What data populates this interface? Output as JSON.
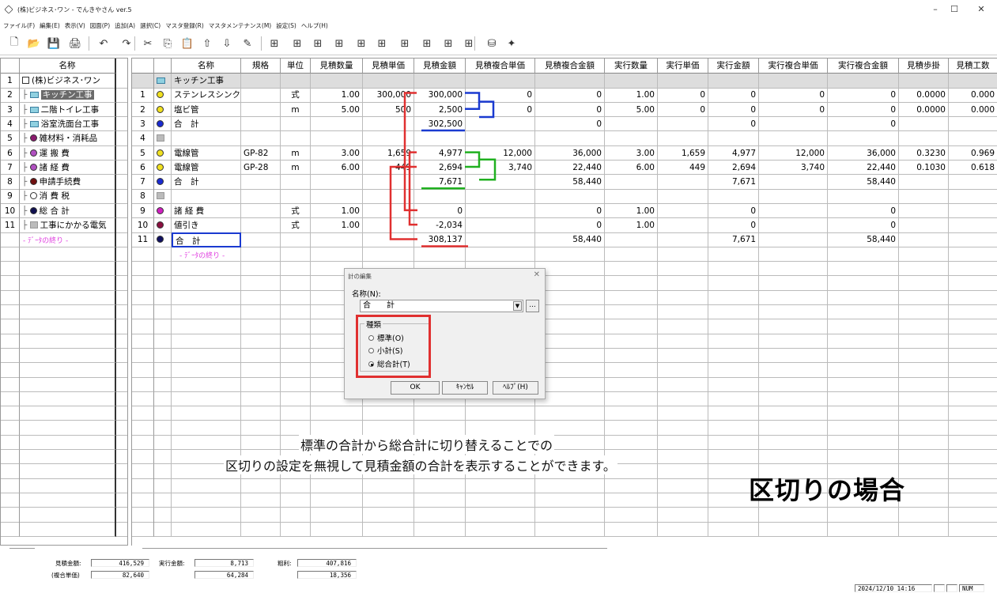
{
  "window": {
    "title": "(株)ビジネス･ワン - でんきやさん ver.5",
    "minimize": "–",
    "maximize": "☐",
    "close": "✕"
  },
  "menu": [
    "ファイル(F)",
    "編集(E)",
    "表示(V)",
    "図面(P)",
    "追加(A)",
    "選択(C)",
    "マスタ登録(R)",
    "マスタメンテナンス(M)",
    "設定(S)",
    "ヘルプ(H)"
  ],
  "toolbar_icons": [
    "new-file-icon",
    "open-folder-icon",
    "save-icon",
    "print-icon",
    "undo-icon",
    "redo-icon",
    "cut-icon",
    "copy-icon",
    "paste-icon",
    "move-up-icon",
    "move-down-icon",
    "edit-icon",
    "tool-1-icon",
    "tool-2-icon",
    "tool-3-icon",
    "tool-4-icon",
    "tool-5-icon",
    "tool-6-icon",
    "tool-7-icon",
    "tool-8-icon",
    "tool-9-icon",
    "tool-10-icon",
    "database-icon",
    "pin-icon"
  ],
  "tree": {
    "header": "名称",
    "rows": [
      {
        "n": "1",
        "label": "(株)ビジネス･ワン",
        "icon": "folder-icon"
      },
      {
        "n": "2",
        "label": "キッチン工事",
        "icon": "item-icon",
        "selected": true
      },
      {
        "n": "3",
        "label": "二階トイレ工事",
        "icon": "item-icon"
      },
      {
        "n": "4",
        "label": "浴室洗面台工事",
        "icon": "item-icon"
      },
      {
        "n": "5",
        "label": "雑材料・消耗品",
        "icon": "dot-icon",
        "color": "#8a1a6e"
      },
      {
        "n": "6",
        "label": "運 搬 費",
        "icon": "dot-icon",
        "color": "#b050c0"
      },
      {
        "n": "7",
        "label": "諸 経 費",
        "icon": "dot-icon",
        "color": "#b050c0"
      },
      {
        "n": "8",
        "label": "申請手続費",
        "icon": "dot-icon",
        "color": "#701010"
      },
      {
        "n": "9",
        "label": "消 費 税",
        "icon": "dot-icon",
        "color": "#ffffff"
      },
      {
        "n": "10",
        "label": "総 合 計",
        "icon": "dot-icon",
        "color": "#101050"
      },
      {
        "n": "11",
        "label": "工事にかかる電気",
        "icon": "gray-icon"
      }
    ],
    "end_label": "- ﾃﾞｰﾀの終り -"
  },
  "grid": {
    "columns": [
      "名称",
      "規格",
      "単位",
      "見積数量",
      "見積単価",
      "見積金額",
      "見積複合単価",
      "見積複合金額",
      "実行数量",
      "実行単価",
      "実行金額",
      "実行複合単価",
      "実行複合金額",
      "見積歩掛",
      "見積工数"
    ],
    "rows": [
      {
        "n": "",
        "icon": "rect",
        "color": "",
        "name": "キッチン工事",
        "spec": "",
        "unit": "",
        "eqty": "",
        "eprice": "",
        "eamt": "",
        "ecp": "",
        "eca": "",
        "aqty": "",
        "aprice": "",
        "aamt": "",
        "acp": "",
        "aca": "",
        "bk": "",
        "work": "",
        "header": true
      },
      {
        "n": "1",
        "icon": "dot",
        "color": "#f0e020",
        "name": "ステンレスシンク",
        "spec": "",
        "unit": "式",
        "eqty": "1.00",
        "eprice": "300,000",
        "eamt": "300,000",
        "ecp": "0",
        "eca": "0",
        "aqty": "1.00",
        "aprice": "0",
        "aamt": "0",
        "acp": "0",
        "aca": "0",
        "bk": "0.0000",
        "work": "0.000"
      },
      {
        "n": "2",
        "icon": "dot",
        "color": "#f0e020",
        "name": "塩ビ管",
        "spec": "",
        "unit": "m",
        "eqty": "5.00",
        "eprice": "500",
        "eamt": "2,500",
        "ecp": "0",
        "eca": "0",
        "aqty": "5.00",
        "aprice": "0",
        "aamt": "0",
        "acp": "0",
        "aca": "0",
        "bk": "0.0000",
        "work": "0.000"
      },
      {
        "n": "3",
        "icon": "dot",
        "color": "#1a2ad0",
        "name": "合　計",
        "spec": "",
        "unit": "",
        "eqty": "",
        "eprice": "",
        "eamt": "302,500",
        "ecp": "",
        "eca": "0",
        "aqty": "",
        "aprice": "",
        "aamt": "0",
        "acp": "",
        "aca": "0",
        "bk": "",
        "work": ""
      },
      {
        "n": "4",
        "icon": "gray",
        "color": "",
        "name": "",
        "spec": "",
        "unit": "",
        "eqty": "",
        "eprice": "",
        "eamt": "",
        "ecp": "",
        "eca": "",
        "aqty": "",
        "aprice": "",
        "aamt": "",
        "acp": "",
        "aca": "",
        "bk": "",
        "work": ""
      },
      {
        "n": "5",
        "icon": "dot",
        "color": "#f0e020",
        "name": "電線管",
        "spec": "GP-82",
        "unit": "m",
        "eqty": "3.00",
        "eprice": "1,659",
        "eamt": "4,977",
        "ecp": "12,000",
        "eca": "36,000",
        "aqty": "3.00",
        "aprice": "1,659",
        "aamt": "4,977",
        "acp": "12,000",
        "aca": "36,000",
        "bk": "0.3230",
        "work": "0.969"
      },
      {
        "n": "6",
        "icon": "dot",
        "color": "#f0e020",
        "name": "電線管",
        "spec": "GP-28",
        "unit": "m",
        "eqty": "6.00",
        "eprice": "449",
        "eamt": "2,694",
        "ecp": "3,740",
        "eca": "22,440",
        "aqty": "6.00",
        "aprice": "449",
        "aamt": "2,694",
        "acp": "3,740",
        "aca": "22,440",
        "bk": "0.1030",
        "work": "0.618"
      },
      {
        "n": "7",
        "icon": "dot",
        "color": "#1a2ad0",
        "name": "合　計",
        "spec": "",
        "unit": "",
        "eqty": "",
        "eprice": "",
        "eamt": "7,671",
        "ecp": "",
        "eca": "58,440",
        "aqty": "",
        "aprice": "",
        "aamt": "7,671",
        "acp": "",
        "aca": "58,440",
        "bk": "",
        "work": ""
      },
      {
        "n": "8",
        "icon": "gray",
        "color": "",
        "name": "",
        "spec": "",
        "unit": "",
        "eqty": "",
        "eprice": "",
        "eamt": "",
        "ecp": "",
        "eca": "",
        "aqty": "",
        "aprice": "",
        "aamt": "",
        "acp": "",
        "aca": "",
        "bk": "",
        "work": ""
      },
      {
        "n": "9",
        "icon": "dot",
        "color": "#d020c0",
        "name": "諸 経 費",
        "spec": "",
        "unit": "式",
        "eqty": "1.00",
        "eprice": "",
        "eamt": "0",
        "ecp": "",
        "eca": "0",
        "aqty": "1.00",
        "aprice": "",
        "aamt": "0",
        "acp": "",
        "aca": "0",
        "bk": "",
        "work": ""
      },
      {
        "n": "10",
        "icon": "dot",
        "color": "#8a1040",
        "name": "値引き",
        "spec": "",
        "unit": "式",
        "eqty": "1.00",
        "eprice": "",
        "eamt": "-2,034",
        "ecp": "",
        "eca": "0",
        "aqty": "1.00",
        "aprice": "",
        "aamt": "0",
        "acp": "",
        "aca": "0",
        "bk": "",
        "work": ""
      },
      {
        "n": "11",
        "icon": "dot",
        "color": "#101060",
        "name": "合　計",
        "spec": "",
        "unit": "",
        "eqty": "",
        "eprice": "",
        "eamt": "308,137",
        "ecp": "",
        "eca": "58,440",
        "aqty": "",
        "aprice": "",
        "aamt": "7,671",
        "acp": "",
        "aca": "58,440",
        "bk": "",
        "work": ""
      }
    ],
    "end_label": "- ﾃﾞｰﾀの終り -"
  },
  "status": {
    "est_amount_label": "見積金額:",
    "est_amount": "416,529",
    "exec_amount_label": "実行金額:",
    "exec_amount": "8,713",
    "profit_label": "粗利:",
    "profit": "407,816",
    "composite_label": "(複合単価)",
    "composite": "82,640",
    "exec_composite": "64,284",
    "profit_composite": "18,356",
    "datetime": "2024/12/10 14:16",
    "num": "NUM"
  },
  "dialog": {
    "title": "計の編集",
    "close": "✕",
    "name_label": "名称(N):",
    "name_value": "合　　計",
    "dots": "...",
    "group_title": "種類",
    "options": [
      "標準(O)",
      "小計(S)",
      "総合計(T)"
    ],
    "selected": 2,
    "ok": "OK",
    "cancel": "ｷｬﾝｾﾙ",
    "help": "ﾍﾙﾌﾟ(H)"
  },
  "caption": {
    "line1": "標準の合計から総合計に切り替えることでの",
    "line2": "区切りの設定を無視して見積金額の合計を表示することができます。",
    "big": "区切りの場合"
  },
  "colors": {
    "red": "#e03030",
    "blue": "#1a3ad0",
    "green": "#20b020",
    "selection": "#2050a0"
  }
}
